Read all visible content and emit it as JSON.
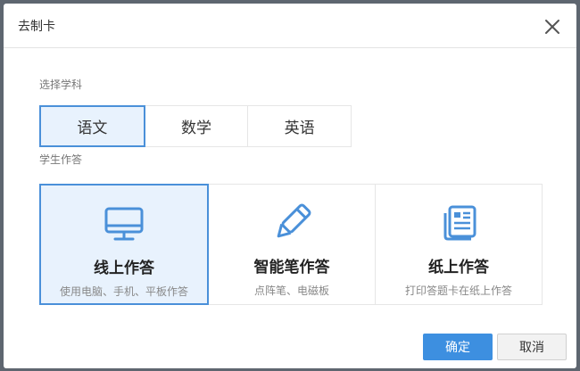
{
  "dialog": {
    "title": "去制卡",
    "close_icon": "close-icon"
  },
  "subject_section": {
    "label": "选择学科",
    "tabs": [
      {
        "label": "语文",
        "selected": true
      },
      {
        "label": "数学",
        "selected": false
      },
      {
        "label": "英语",
        "selected": false
      }
    ]
  },
  "answer_section": {
    "label": "学生作答",
    "modes": [
      {
        "icon": "monitor-icon",
        "title": "线上作答",
        "desc": "使用电脑、手机、平板作答",
        "selected": true
      },
      {
        "icon": "pen-icon",
        "title": "智能笔作答",
        "desc": "点阵笔、电磁板",
        "selected": false
      },
      {
        "icon": "document-icon",
        "title": "纸上作答",
        "desc": "打印答题卡在纸上作答",
        "selected": false
      }
    ]
  },
  "footer": {
    "ok_label": "确定",
    "cancel_label": "取消"
  },
  "colors": {
    "accent": "#4a90d9",
    "selected_bg": "#e8f2fd",
    "primary_button": "#3d8fe0"
  }
}
